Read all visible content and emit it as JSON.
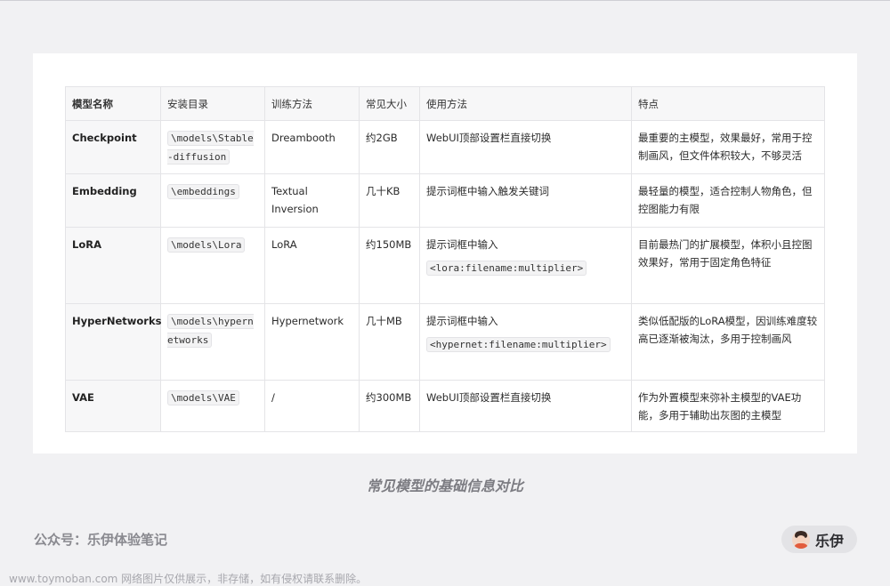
{
  "table": {
    "headers": [
      "模型名称",
      "安装目录",
      "训练方法",
      "常见大小",
      "使用方法",
      "特点"
    ],
    "rows": [
      {
        "name": "Checkpoint",
        "dir": "\\models\\Stable-diffusion",
        "training": "Dreambooth",
        "size": "约2GB",
        "usage_text": "WebUI顶部设置栏直接切换",
        "usage_code": "",
        "features": "最重要的主模型，效果最好，常用于控制画风，但文件体积较大，不够灵活"
      },
      {
        "name": "Embedding",
        "dir": "\\embeddings",
        "training": "Textual Inversion",
        "size": "几十KB",
        "usage_text": "提示词框中输入触发关键词",
        "usage_code": "",
        "features": "最轻量的模型，适合控制人物角色，但控图能力有限"
      },
      {
        "name": "LoRA",
        "dir": "\\models\\Lora",
        "training": "LoRA",
        "size": "约150MB",
        "usage_text": "提示词框中输入",
        "usage_code": "<lora:filename:multiplier>",
        "features": "目前最热门的扩展模型，体积小且控图效果好，常用于固定角色特征"
      },
      {
        "name": "HyperNetworks",
        "dir": "\\models\\hypernetworks",
        "training": "Hypernetwork",
        "size": "几十MB",
        "usage_text": "提示词框中输入",
        "usage_code": "<hypernet:filename:multiplier>",
        "features": "类似低配版的LoRA模型，因训练难度较高已逐渐被淘汰，多用于控制画风"
      },
      {
        "name": "VAE",
        "dir": "\\models\\VAE",
        "training": "/",
        "size": "约300MB",
        "usage_text": "WebUI顶部设置栏直接切换",
        "usage_code": "",
        "features": "作为外置模型来弥补主模型的VAE功能，多用于辅助出灰图的主模型"
      }
    ]
  },
  "caption": "常见模型的基础信息对比",
  "footer": {
    "account": "公众号：乐伊体验笔记",
    "author": "乐伊",
    "avatar_icon": "avatar-icon"
  },
  "watermark": "www.toymoban.com 网络图片仅供展示，非存储，如有侵权请联系删除。"
}
